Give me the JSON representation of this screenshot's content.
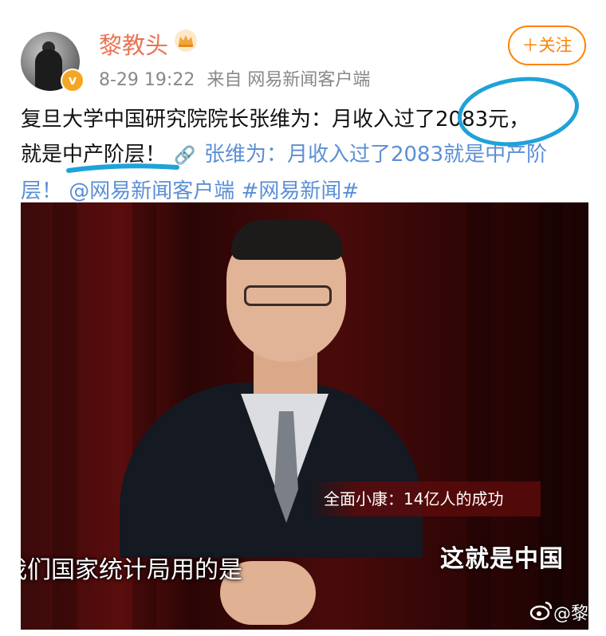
{
  "header": {
    "username": "黎教头",
    "date": "8-29 19:22",
    "source": "来自 网易新闻客户端",
    "follow_label": "＋关注"
  },
  "post": {
    "line1": "复旦大学中国研究院院长张维为：月收入过了2083元，",
    "line2_prefix": "就是中产阶层！",
    "link_text": "张维为：月收入过了2083就是中产阶",
    "line3_link_end": "层！",
    "mention": "@网易新闻客户端",
    "hashtag": "#网易新闻#"
  },
  "video": {
    "banner_text": "全面小康：14亿人的成功",
    "logo_text": "这就是中国",
    "subtitle_text": "我们国家统计局用的是",
    "watermark_text": "@黎"
  },
  "colors": {
    "username": "#eb7350",
    "link": "#5b8fd6",
    "follow": "#ff8200",
    "annotation_blue": "#1fa2d8"
  },
  "icons": {
    "crown": "crown-icon",
    "verified": "verified-badge-icon",
    "link": "link-icon",
    "weibo": "weibo-logo-icon"
  }
}
